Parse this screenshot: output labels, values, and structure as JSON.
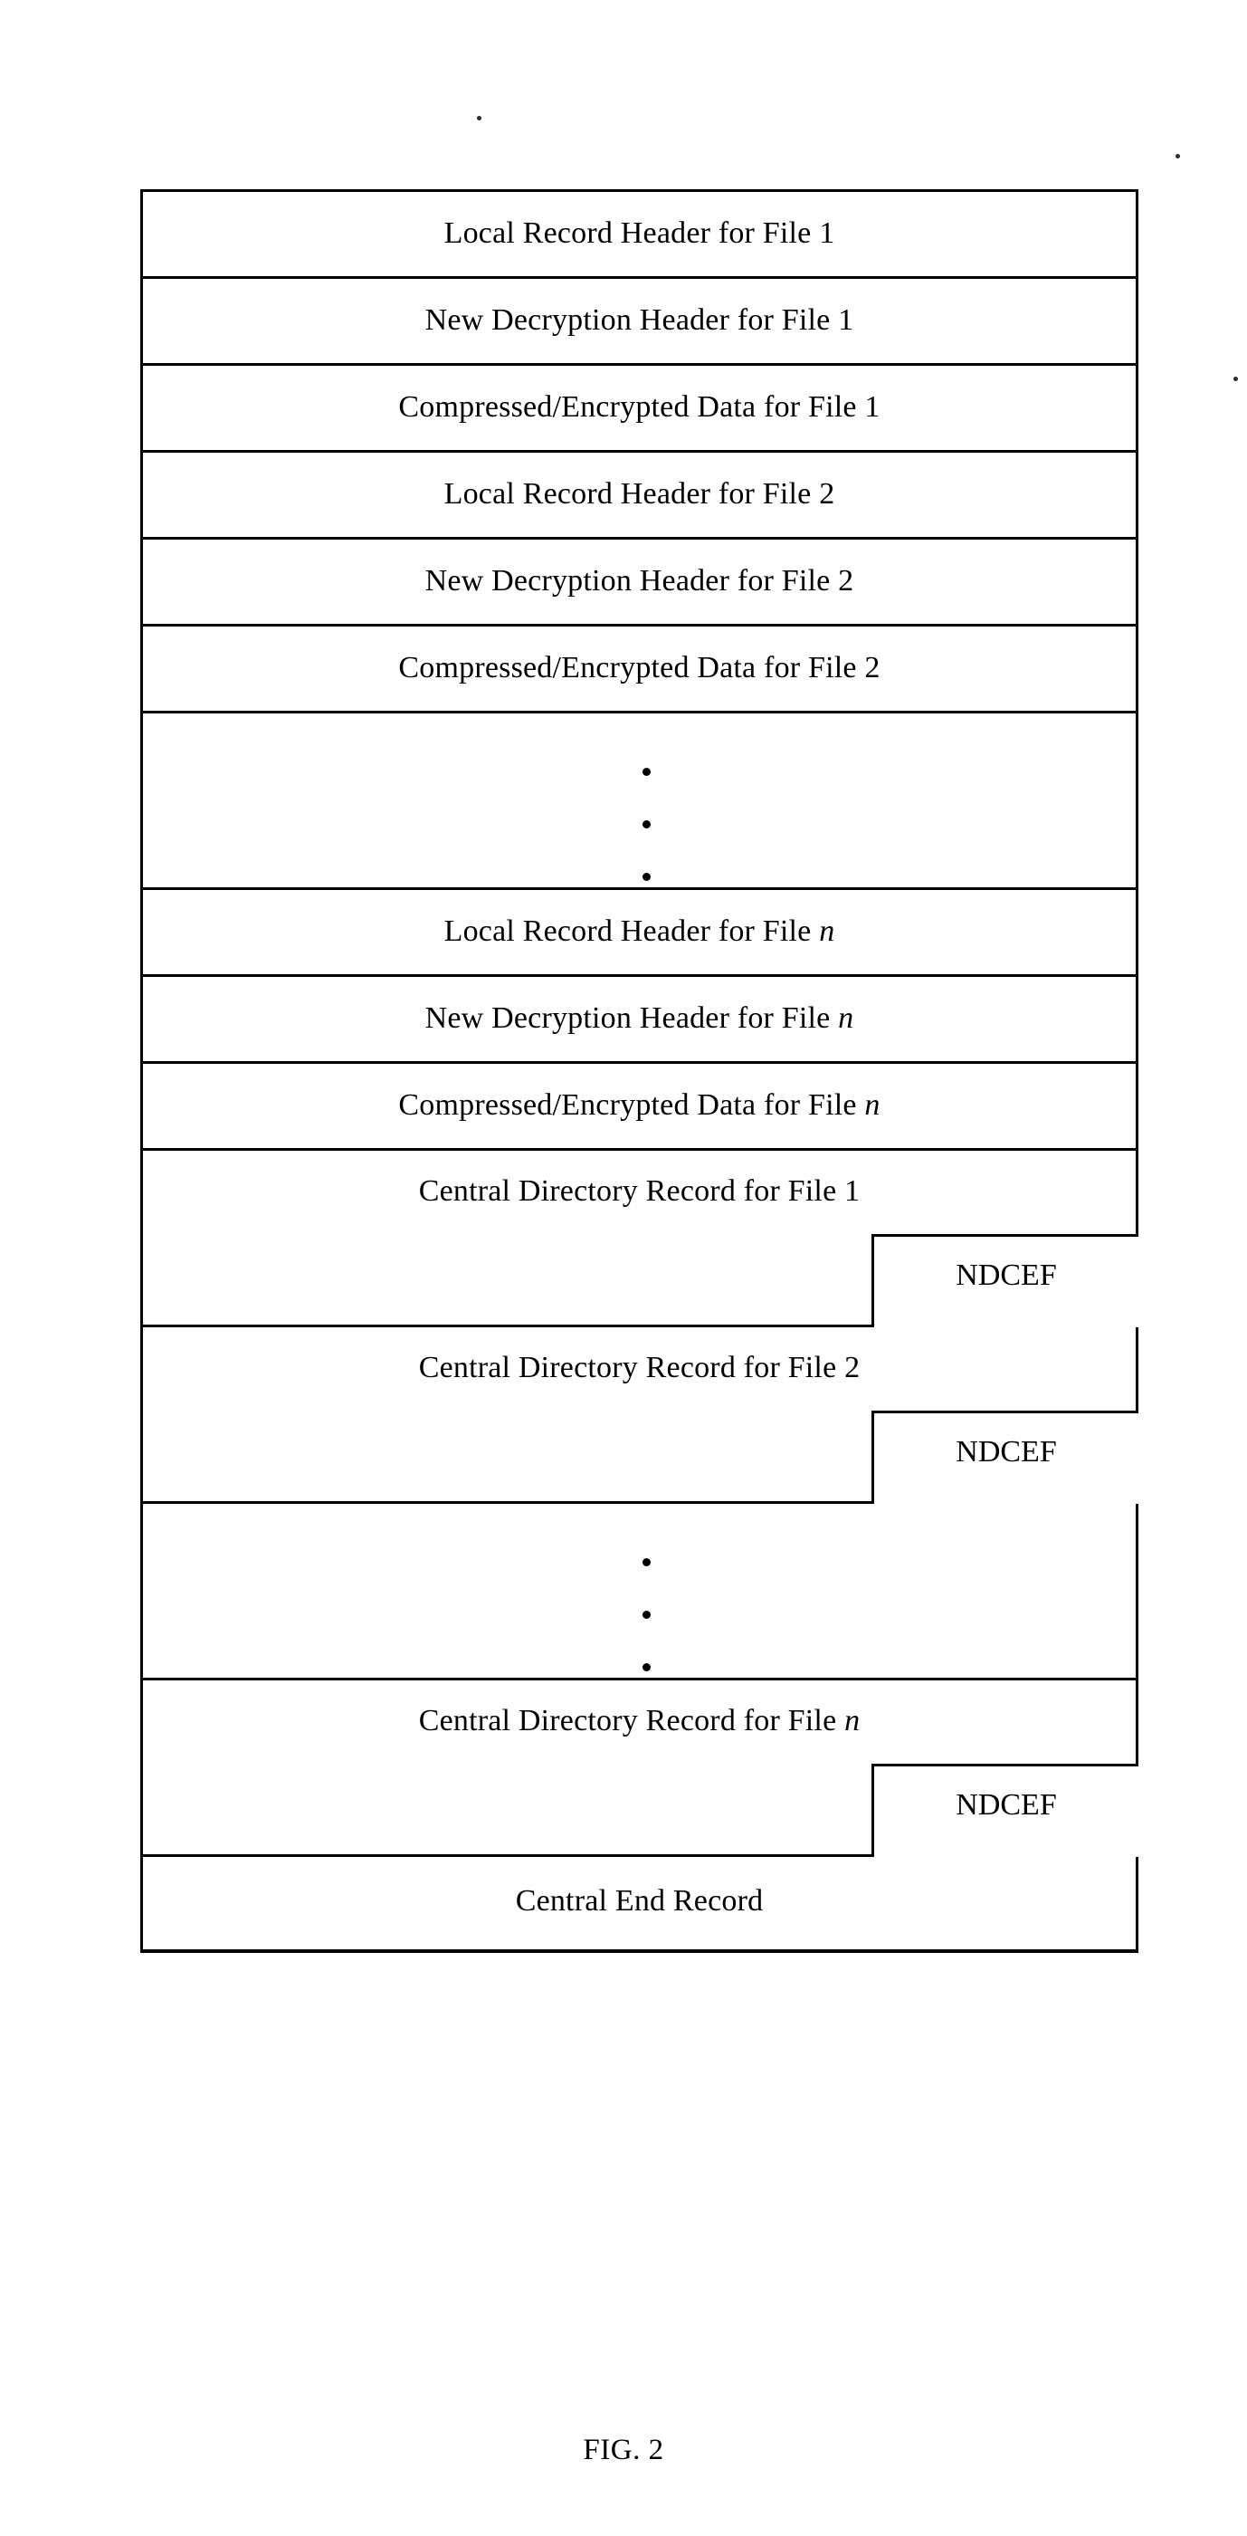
{
  "figure": {
    "caption": "FIG. 2",
    "ndcef_label": "NDCEF",
    "ellipsis_glyph": "•",
    "border_color": "#000000",
    "background_color": "#ffffff",
    "rows": [
      {
        "kind": "simple",
        "label_prefix": "Local Record Header for File ",
        "label_suffix": "1",
        "suffix_italic": false
      },
      {
        "kind": "simple",
        "label_prefix": "New Decryption Header for File ",
        "label_suffix": "1",
        "suffix_italic": false
      },
      {
        "kind": "simple",
        "label_prefix": "Compressed/Encrypted Data for File ",
        "label_suffix": "1",
        "suffix_italic": false
      },
      {
        "kind": "simple",
        "label_prefix": "Local Record Header for File ",
        "label_suffix": "2",
        "suffix_italic": false
      },
      {
        "kind": "simple",
        "label_prefix": "New Decryption Header for File ",
        "label_suffix": "2",
        "suffix_italic": false
      },
      {
        "kind": "simple",
        "label_prefix": "Compressed/Encrypted Data for File ",
        "label_suffix": "2",
        "suffix_italic": false
      },
      {
        "kind": "ellipsis",
        "label_prefix": "",
        "label_suffix": "",
        "suffix_italic": false
      },
      {
        "kind": "simple",
        "label_prefix": "Local Record Header for File ",
        "label_suffix": "n",
        "suffix_italic": true
      },
      {
        "kind": "simple",
        "label_prefix": "New Decryption Header for File ",
        "label_suffix": "n",
        "suffix_italic": true
      },
      {
        "kind": "simple",
        "label_prefix": "Compressed/Encrypted Data for File ",
        "label_suffix": "n",
        "suffix_italic": true
      },
      {
        "kind": "ndcef",
        "label_prefix": "Central Directory Record for File ",
        "label_suffix": "1",
        "suffix_italic": false
      },
      {
        "kind": "ndcef",
        "label_prefix": "Central Directory Record for File ",
        "label_suffix": "2",
        "suffix_italic": false
      },
      {
        "kind": "ellipsis",
        "label_prefix": "",
        "label_suffix": "",
        "suffix_italic": false
      },
      {
        "kind": "ndcef",
        "label_prefix": "Central Directory Record for File ",
        "label_suffix": "n",
        "suffix_italic": true
      },
      {
        "kind": "end",
        "label_prefix": "Central End Record",
        "label_suffix": "",
        "suffix_italic": false
      }
    ]
  }
}
